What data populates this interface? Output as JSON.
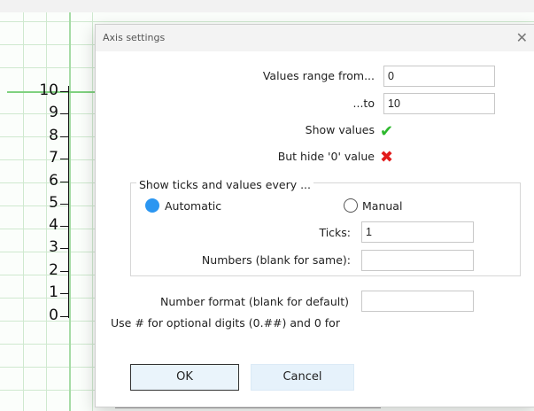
{
  "background_axis": {
    "tick_labels": [
      "10",
      "9",
      "8",
      "7",
      "6",
      "5",
      "4",
      "3",
      "2",
      "1",
      "0"
    ]
  },
  "dialog": {
    "title": "Axis settings",
    "values_range_label": "Values range from...",
    "values_range_from": "0",
    "to_label": "...to",
    "to_value": "10",
    "show_values_label": "Show values",
    "hide_zero_label": "But hide '0' value",
    "group_legend": "Show ticks and values every ...",
    "automatic_label": "Automatic",
    "manual_label": "Manual",
    "ticks_label": "Ticks:",
    "ticks_value": "1",
    "numbers_label": "Numbers (blank for same):",
    "numbers_value": "",
    "number_format_label": "Number format (blank for default)",
    "number_format_value": "",
    "hint_text": "Use # for optional digits (0.##) and 0 for",
    "ok_label": "OK",
    "cancel_label": "Cancel",
    "colors": {
      "check": "#2db82d",
      "cross": "#e21b1b",
      "radio_selected": "#2b96f1"
    }
  }
}
